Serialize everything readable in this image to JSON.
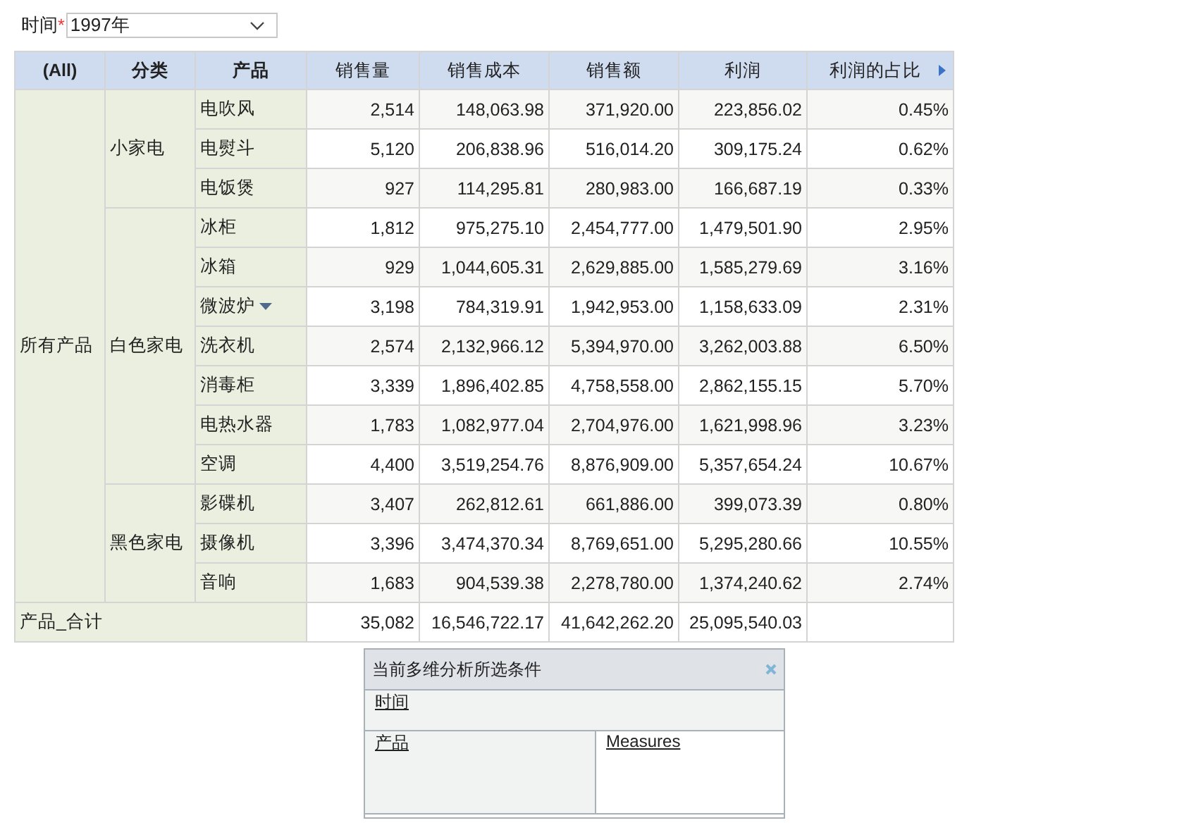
{
  "filter": {
    "label": "时间",
    "required_mark": "*",
    "value": "1997年"
  },
  "table": {
    "columns": [
      "(All)",
      "分类",
      "产品",
      "销售量",
      "销售成本",
      "销售额",
      "利润",
      "利润的占比"
    ],
    "top_label": "所有产品",
    "groups": [
      {
        "category": "小家电",
        "rows": [
          {
            "product": "电吹风",
            "menu": false,
            "values": [
              "2,514",
              "148,063.98",
              "371,920.00",
              "223,856.02",
              "0.45%"
            ]
          },
          {
            "product": "电熨斗",
            "menu": false,
            "values": [
              "5,120",
              "206,838.96",
              "516,014.20",
              "309,175.24",
              "0.62%"
            ]
          },
          {
            "product": "电饭煲",
            "menu": false,
            "values": [
              "927",
              "114,295.81",
              "280,983.00",
              "166,687.19",
              "0.33%"
            ]
          }
        ]
      },
      {
        "category": "白色家电",
        "rows": [
          {
            "product": "冰柜",
            "menu": false,
            "values": [
              "1,812",
              "975,275.10",
              "2,454,777.00",
              "1,479,501.90",
              "2.95%"
            ]
          },
          {
            "product": "冰箱",
            "menu": false,
            "values": [
              "929",
              "1,044,605.31",
              "2,629,885.00",
              "1,585,279.69",
              "3.16%"
            ]
          },
          {
            "product": "微波炉",
            "menu": true,
            "values": [
              "3,198",
              "784,319.91",
              "1,942,953.00",
              "1,158,633.09",
              "2.31%"
            ]
          },
          {
            "product": "洗衣机",
            "menu": false,
            "values": [
              "2,574",
              "2,132,966.12",
              "5,394,970.00",
              "3,262,003.88",
              "6.50%"
            ]
          },
          {
            "product": "消毒柜",
            "menu": false,
            "values": [
              "3,339",
              "1,896,402.85",
              "4,758,558.00",
              "2,862,155.15",
              "5.70%"
            ]
          },
          {
            "product": "电热水器",
            "menu": false,
            "values": [
              "1,783",
              "1,082,977.04",
              "2,704,976.00",
              "1,621,998.96",
              "3.23%"
            ]
          },
          {
            "product": "空调",
            "menu": false,
            "values": [
              "4,400",
              "3,519,254.76",
              "8,876,909.00",
              "5,357,654.24",
              "10.67%"
            ]
          }
        ]
      },
      {
        "category": "黑色家电",
        "rows": [
          {
            "product": "影碟机",
            "menu": false,
            "values": [
              "3,407",
              "262,812.61",
              "661,886.00",
              "399,073.39",
              "0.80%"
            ]
          },
          {
            "product": "摄像机",
            "menu": false,
            "values": [
              "3,396",
              "3,474,370.34",
              "8,769,651.00",
              "5,295,280.66",
              "10.55%"
            ]
          },
          {
            "product": "音响",
            "menu": false,
            "values": [
              "1,683",
              "904,539.38",
              "2,278,780.00",
              "1,374,240.62",
              "2.74%"
            ]
          }
        ]
      }
    ],
    "total": {
      "label": "产品_合计",
      "values": [
        "35,082",
        "16,546,722.17",
        "41,642,262.20",
        "25,095,540.03"
      ]
    }
  },
  "conditions_panel": {
    "title": "当前多维分析所选条件",
    "filter_link": "时间",
    "row_link": "产品",
    "column_link": "Measures"
  }
}
